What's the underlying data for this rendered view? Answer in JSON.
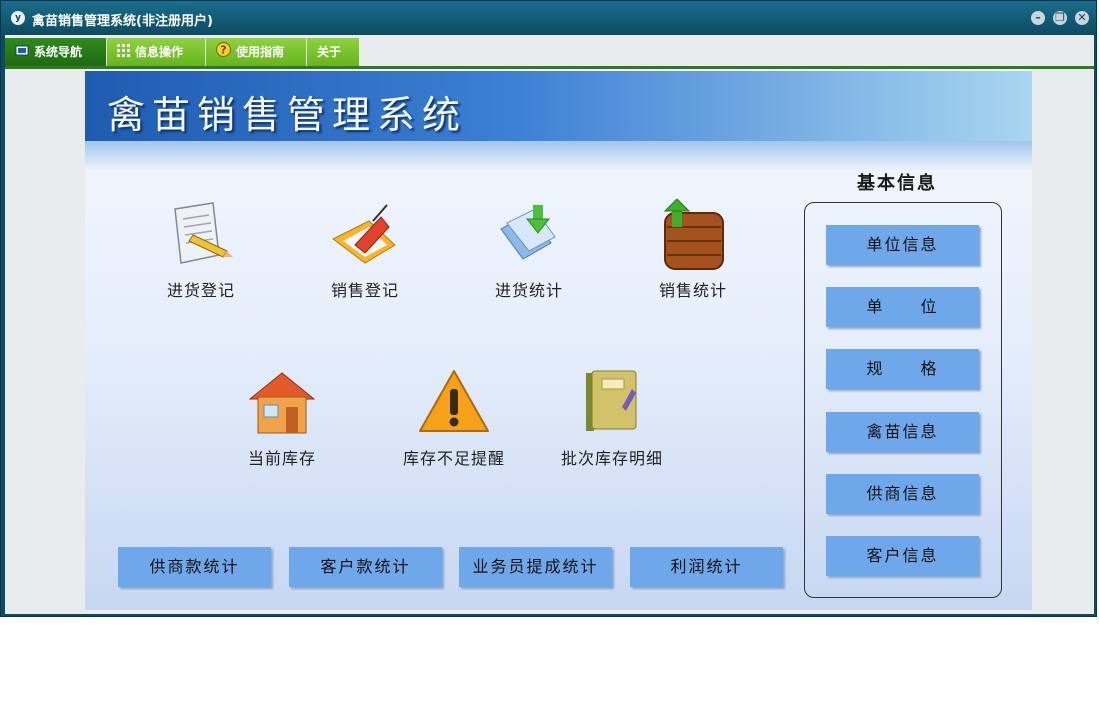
{
  "window": {
    "title": "禽苗销售管理系统(非注册用户)",
    "app_icon_text": "y",
    "buttons": [
      "minimize-icon",
      "restore-icon",
      "close-icon"
    ]
  },
  "menubar": {
    "items": [
      {
        "label": "系统导航",
        "icon": "monitor-icon"
      },
      {
        "label": "信息操作",
        "icon": "grid-icon"
      },
      {
        "label": "使用指南",
        "icon": "help-icon"
      },
      {
        "label": "关于",
        "icon": ""
      }
    ]
  },
  "banner": {
    "title": "禽苗销售管理系统"
  },
  "functions": [
    {
      "label": "进货登记",
      "icon": "document-pencil-icon"
    },
    {
      "label": "销售登记",
      "icon": "folder-pen-icon"
    },
    {
      "label": "进货统计",
      "icon": "files-download-icon"
    },
    {
      "label": "销售统计",
      "icon": "crate-upload-icon"
    },
    {
      "label": "当前库存",
      "icon": "house-icon"
    },
    {
      "label": "库存不足提醒",
      "icon": "warning-icon"
    },
    {
      "label": "批次库存明细",
      "icon": "notebook-icon"
    }
  ],
  "bottom_buttons": [
    "供商款统计",
    "客户款统计",
    "业务员提成统计",
    "利润统计"
  ],
  "basic_info": {
    "title": "基本信息",
    "buttons": [
      "单位信息",
      "单　　位",
      "规　　格",
      "禽苗信息",
      "供商信息",
      "客户信息"
    ]
  },
  "colors": {
    "title_bar": "#0d4a63",
    "menu_green": "#66b41e",
    "button_blue": "#6ea8ea",
    "banner_blue": "#1e5cb0"
  }
}
